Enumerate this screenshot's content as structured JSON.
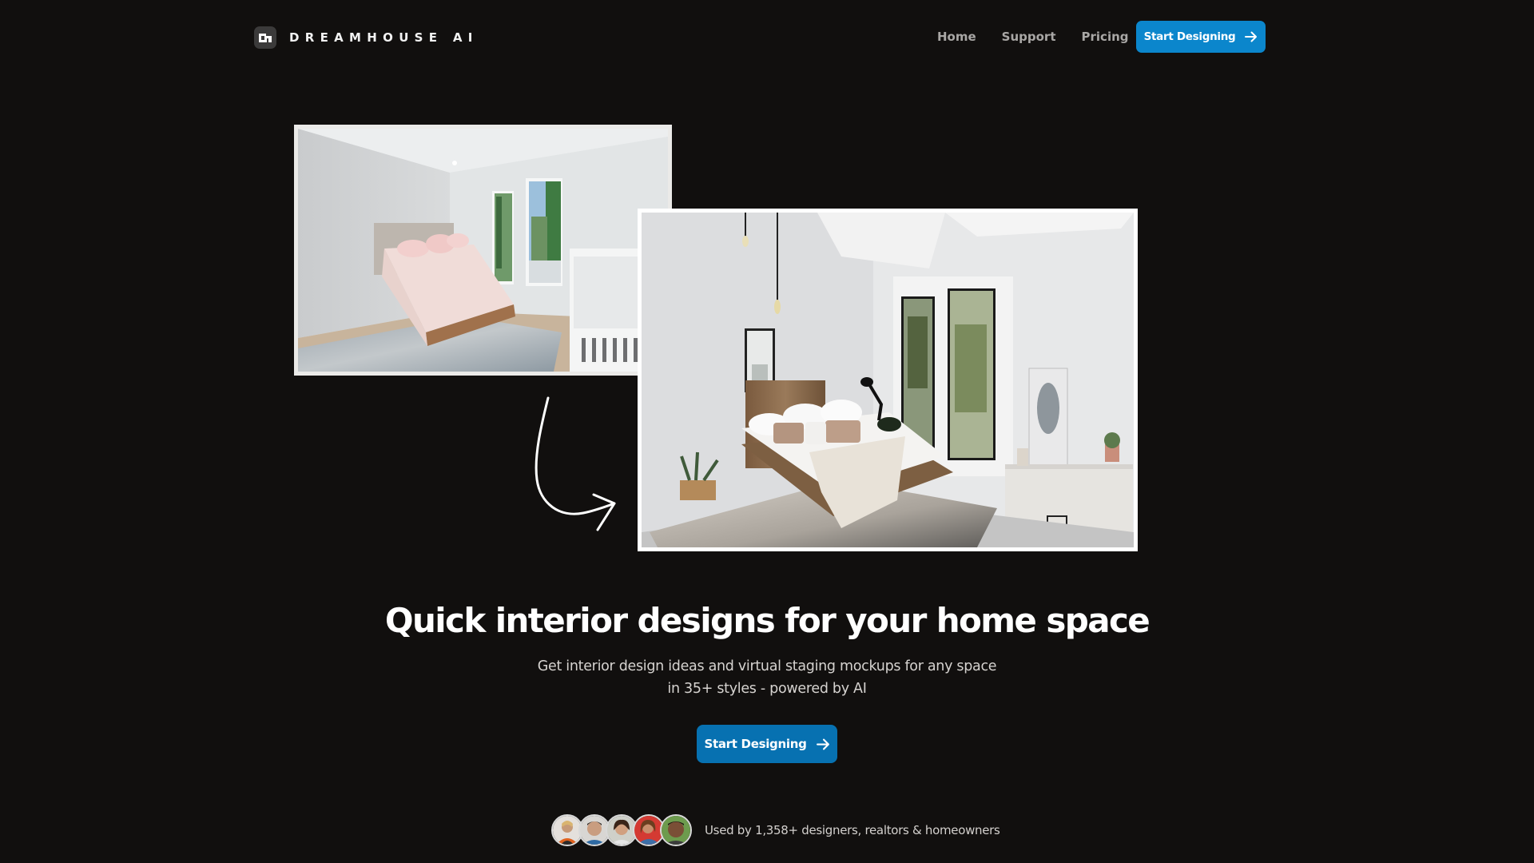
{
  "brand": {
    "name": "DREAMHOUSE AI",
    "logo_icon": "house-door-icon"
  },
  "nav": {
    "links": [
      {
        "label": "Home"
      },
      {
        "label": "Support"
      },
      {
        "label": "Pricing"
      }
    ],
    "cta_label": "Start Designing",
    "cta_icon": "arrow-right-icon"
  },
  "hero": {
    "before_image_alt": "Empty bedroom with plain bed, pink pillows and crib",
    "after_image_alt": "AI-staged rustic bedroom with wooden pallet bed and white linens",
    "transition_icon": "curved-arrow-icon",
    "headline": "Quick interior designs for your home space",
    "subtitle_line1": "Get interior design ideas and virtual staging mockups for any space",
    "subtitle_line2": "in 35+ styles - powered by AI",
    "cta_label": "Start Designing",
    "cta_icon": "arrow-right-icon"
  },
  "social_proof": {
    "avatar_count": 5,
    "text": "Used by 1,358+ designers, realtors & homeowners"
  },
  "colors": {
    "background": "#110f0e",
    "primary_button": "#0b86cc",
    "hero_button": "#0771b1",
    "nav_text": "#a9a7a5"
  }
}
